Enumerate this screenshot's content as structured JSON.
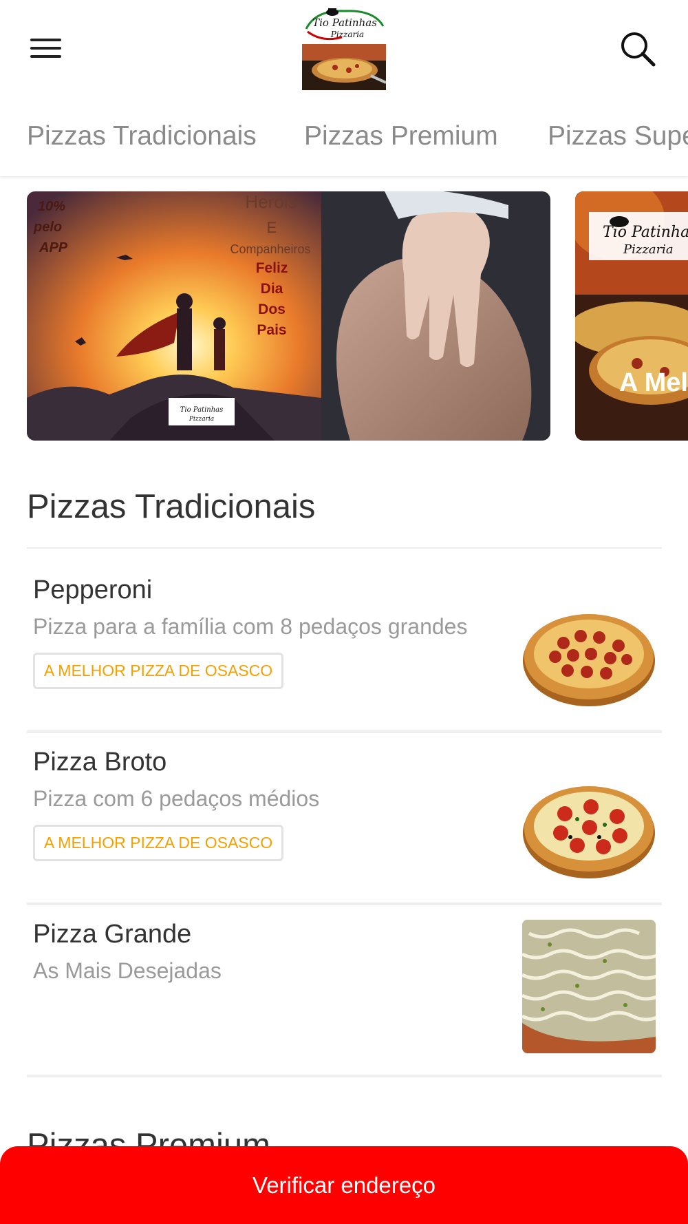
{
  "header": {
    "menu_icon": "hamburger-menu-icon",
    "search_icon": "search-icon",
    "logo": {
      "line1": "Tio Patinhas",
      "line2": "Pizzaria"
    }
  },
  "tabs": [
    {
      "label": "Pizzas Tradicionais"
    },
    {
      "label": "Pizzas Premium"
    },
    {
      "label": "Pizzas Super Premium"
    }
  ],
  "banners": [
    {
      "promo": [
        "10%",
        "pelo",
        "APP"
      ],
      "headline": [
        "Heróis",
        "E",
        "Companheiros"
      ],
      "message": [
        "Feliz",
        "Dia",
        "Dos",
        "Pais"
      ]
    },
    {
      "caption": "A Melhor"
    }
  ],
  "section": {
    "title": "Pizzas Tradicionais",
    "items": [
      {
        "name": "Pepperoni",
        "description": "Pizza para a família com 8 pedaços grandes",
        "tag": "A MELHOR PIZZA DE OSASCO"
      },
      {
        "name": "Pizza Broto",
        "description": "Pizza com 6 pedaços médios",
        "tag": "A MELHOR PIZZA DE OSASCO"
      },
      {
        "name": "Pizza Grande",
        "description": "As Mais Desejadas"
      }
    ]
  },
  "next_section": {
    "title": "Pizzas Premium"
  },
  "cta": {
    "label": "Verificar endereço"
  },
  "colors": {
    "accent": "#ff0000",
    "tag_text": "#f5a000",
    "tab_text": "#8a8a8a"
  }
}
